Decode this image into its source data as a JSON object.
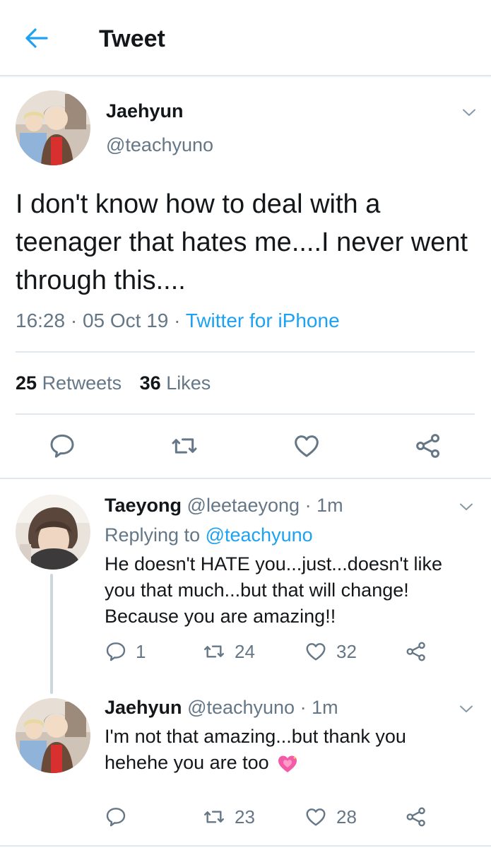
{
  "header": {
    "title": "Tweet"
  },
  "main_tweet": {
    "name": "Jaehyun",
    "handle": "@teachyuno",
    "text": "I don't know how to deal with a teenager that hates me....I never went through this....",
    "time": "16:28",
    "sep1": "·",
    "date": "05 Oct 19",
    "sep2": "·",
    "source": "Twitter for iPhone",
    "retweets_count": "25",
    "retweets_label": "Retweets",
    "likes_count": "36",
    "likes_label": "Likes"
  },
  "replies": [
    {
      "name": "Taeyong",
      "handle": "@leetaeyong",
      "sep": "·",
      "time": "1m",
      "replying_prefix": "Replying to",
      "replying_to": "@teachyuno",
      "text": "He doesn't HATE you...just...doesn't like you that much...but that will change! Because you are amazing!!",
      "reply_count": "1",
      "retweet_count": "24",
      "like_count": "32"
    },
    {
      "name": "Jaehyun",
      "handle": "@teachyuno",
      "sep": "·",
      "time": "1m",
      "text": "I'm not that amazing...but thank you hehehe you are too",
      "emoji": "sparkling-heart-emoji",
      "retweet_count": "23",
      "like_count": "28"
    }
  ],
  "colors": {
    "accent": "#1da1f2",
    "text": "#14171a",
    "secondary": "#657786",
    "divider": "#e1e8ed",
    "thread_line": "#ccd6dd",
    "emoji_pink": "#f45ba6"
  },
  "icons": [
    "back-arrow-icon",
    "chevron-down-icon",
    "reply-icon",
    "retweet-icon",
    "like-icon",
    "share-icon"
  ]
}
